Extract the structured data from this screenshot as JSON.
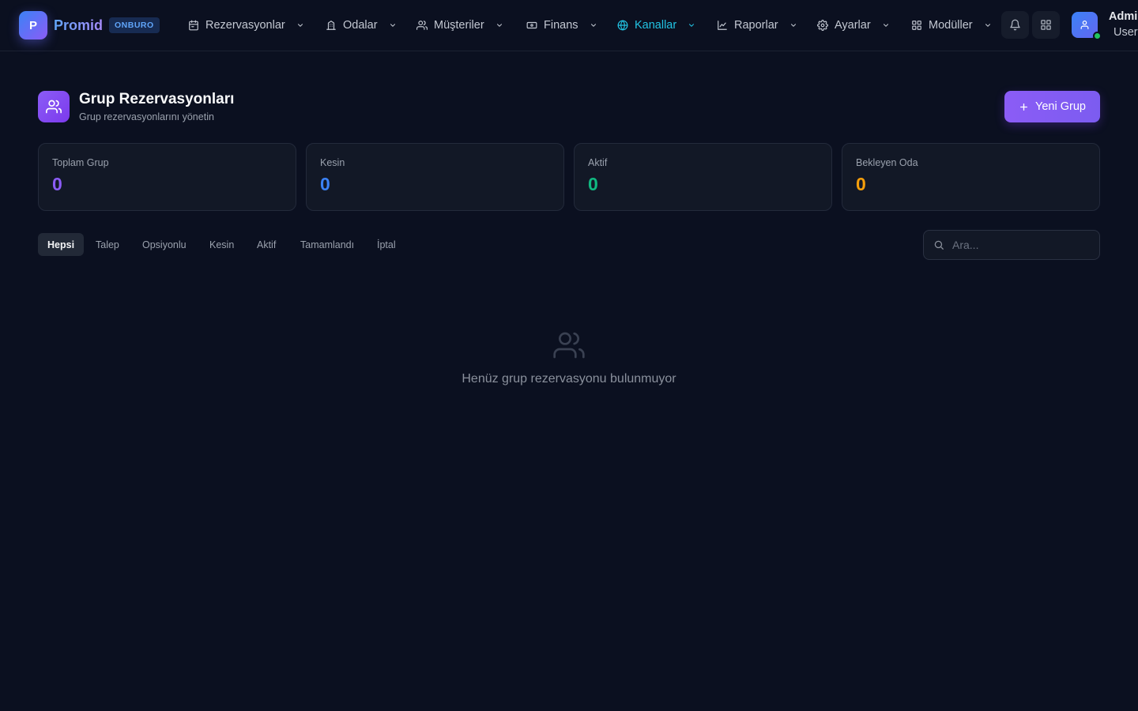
{
  "brand": {
    "logo_letter": "P",
    "name": "Promid",
    "badge": "ONBURO"
  },
  "nav": {
    "items": [
      {
        "label": "Rezervasyonlar",
        "icon": "calendar-icon"
      },
      {
        "label": "Odalar",
        "icon": "building-icon"
      },
      {
        "label": "Müşteriler",
        "icon": "users-icon"
      },
      {
        "label": "Finans",
        "icon": "banknote-icon"
      },
      {
        "label": "Kanallar",
        "icon": "globe-icon",
        "active": true
      },
      {
        "label": "Raporlar",
        "icon": "chart-icon"
      },
      {
        "label": "Ayarlar",
        "icon": "gear-icon"
      },
      {
        "label": "Modüller",
        "icon": "grid-icon"
      }
    ],
    "active_color": "#22c4e4"
  },
  "header_actions": {
    "notifications_icon": "bell-icon",
    "apps_icon": "apps-grid-icon"
  },
  "user": {
    "name": "Admin",
    "role": "User",
    "status": "online"
  },
  "page": {
    "title": "Grup Rezervasyonları",
    "subtitle": "Grup rezervasyonlarını yönetin",
    "icon": "users-icon",
    "new_button_label": "Yeni Grup"
  },
  "stats": [
    {
      "label": "Toplam Grup",
      "value": "0",
      "color": "#8b5cf6"
    },
    {
      "label": "Kesin",
      "value": "0",
      "color": "#3b82f6"
    },
    {
      "label": "Aktif",
      "value": "0",
      "color": "#10b981"
    },
    {
      "label": "Bekleyen Oda",
      "value": "0",
      "color": "#f59e0b"
    }
  ],
  "filters": {
    "tabs": [
      "Hepsi",
      "Talep",
      "Opsiyonlu",
      "Kesin",
      "Aktif",
      "Tamamlandı",
      "İptal"
    ],
    "active": "Hepsi"
  },
  "search": {
    "placeholder": "Ara...",
    "value": ""
  },
  "empty_state": {
    "message": "Henüz grup rezervasyonu bulunmuyor",
    "icon": "users-icon"
  },
  "colors": {
    "background": "#0b1020",
    "accent": "#8b5cf6"
  }
}
